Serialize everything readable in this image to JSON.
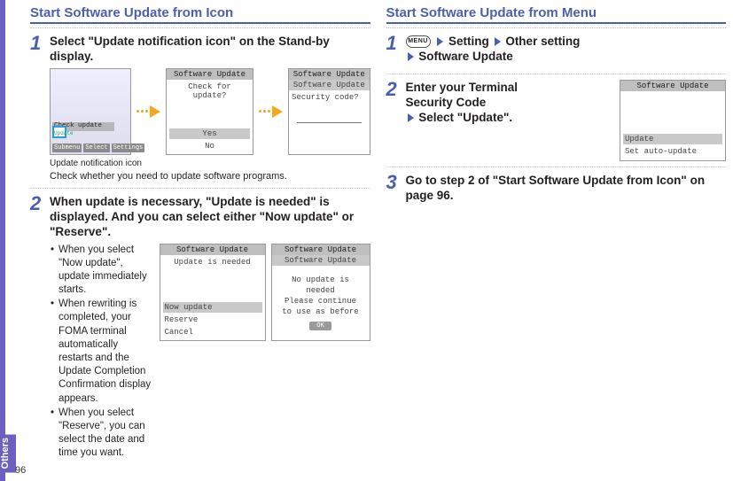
{
  "page_number": "96",
  "side_tab": "Others",
  "left": {
    "title": "Start Software Update from Icon",
    "step1": {
      "num": "1",
      "head": "Select \"Update notification icon\" on the Stand-by display.",
      "standby_strip": "Check update",
      "standby_icon": "Update",
      "standby_soft": {
        "l": "Submenu",
        "c": "Select",
        "r": "Settings"
      },
      "scrB1_title": "Software Update",
      "scrB1_text": "Check for update?",
      "scrB1_opt_sel": "Yes",
      "scrB1_opt": "No",
      "scrB2_title": "Software Update",
      "scrB2_sub": "Software Update",
      "scrB2_text": "Security code?",
      "caption": "Update notification icon",
      "note": "Check whether you need to update software programs."
    },
    "step2": {
      "num": "2",
      "head": "When update is necessary, \"Update is needed\" is displayed. And you can select either \"Now update\" or \"Reserve\".",
      "bul1": "When you select \"Now update\", update immediately starts.",
      "bul2": "When rewriting is completed, your FOMA terminal automatically restarts and the Update Completion Confirmation display appears.",
      "bul3": "When you select \"Reserve\", you can select the date and time you want.",
      "scrC1_title": "Software Update",
      "scrC1_text": "Update is needed",
      "scrC1_opt_sel": "Now update",
      "scrC1_opt2": "Reserve",
      "scrC1_opt3": "Cancel",
      "scrC2_title": "Software Update",
      "scrC2_sub": "Software Update",
      "scrC2_line1": "No update is",
      "scrC2_line2": "needed",
      "scrC2_line3": "Please continue",
      "scrC2_line4": "to use as before",
      "scrC2_ok": "OK"
    }
  },
  "right": {
    "title": "Start Software Update from Menu",
    "step1": {
      "num": "1",
      "menu": "MENU",
      "p1": "Setting",
      "p2": "Other setting",
      "p3": "Software Update"
    },
    "step2": {
      "num": "2",
      "head_l1": "Enter your Terminal",
      "head_l2": "Security Code",
      "head_l3": "Select \"Update\".",
      "scr_title": "Software Update",
      "scr_opt_sel": "Update",
      "scr_opt2": "Set auto-update"
    },
    "step3": {
      "num": "3",
      "head": "Go to step 2 of \"Start Software Update from Icon\" on page 96."
    }
  }
}
